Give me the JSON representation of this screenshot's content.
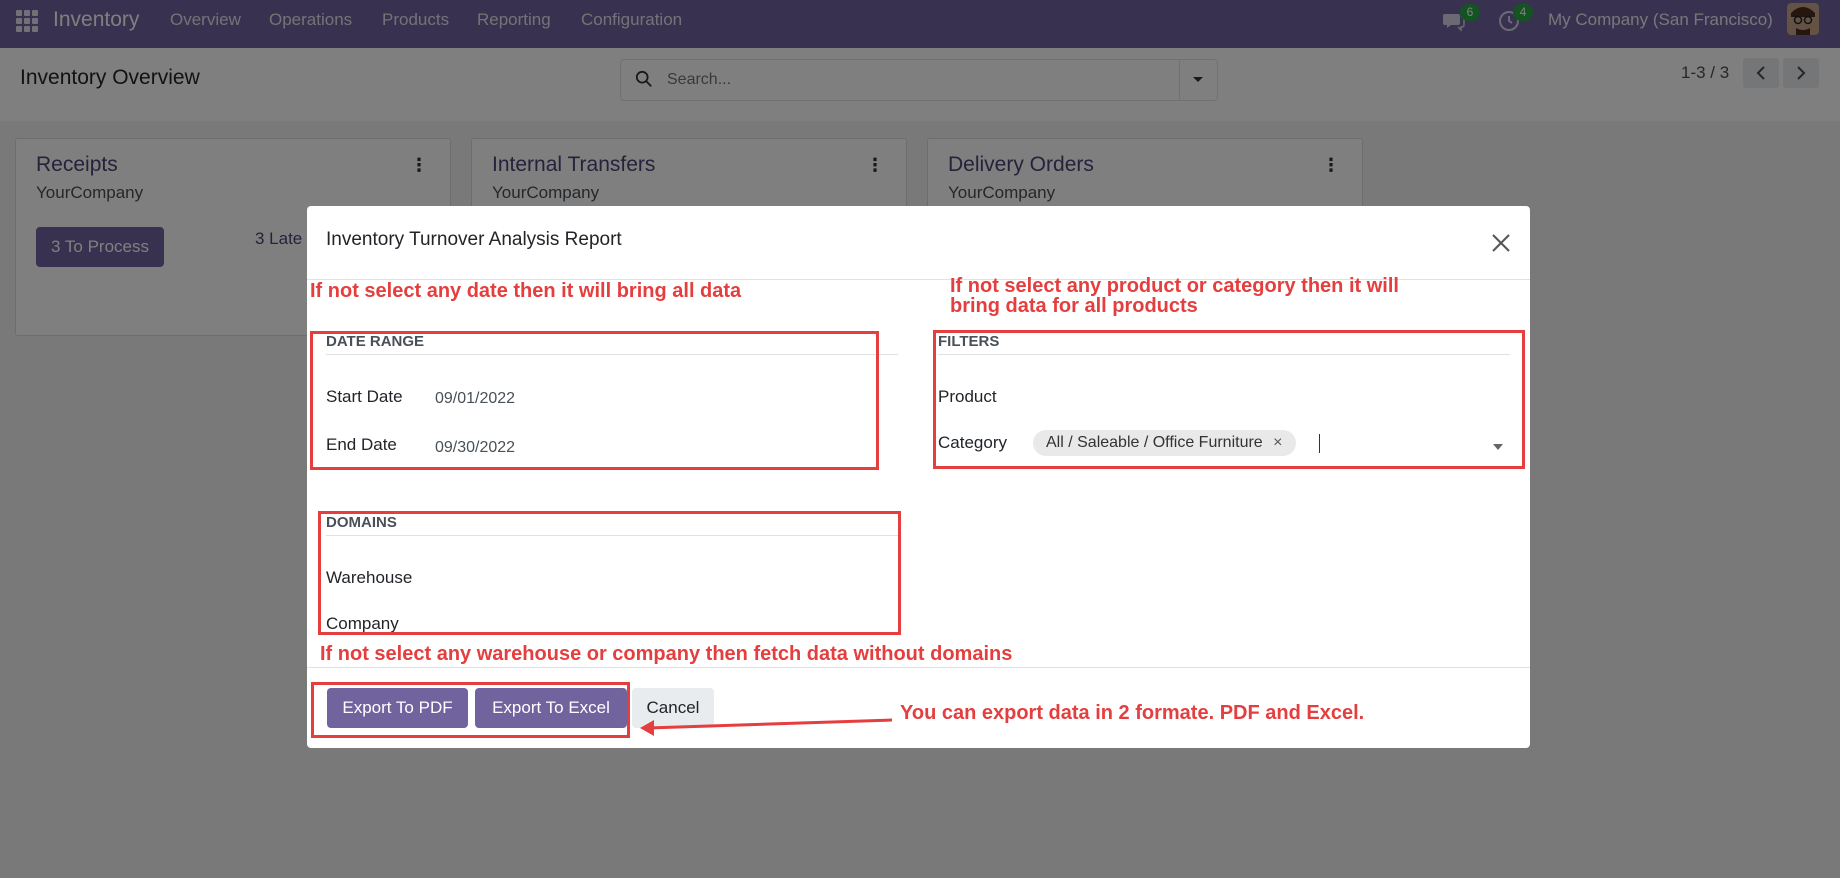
{
  "navbar": {
    "app_name": "Inventory",
    "menu": [
      "Overview",
      "Operations",
      "Products",
      "Reporting",
      "Configuration"
    ],
    "messages_badge": "6",
    "activities_badge": "4",
    "company": "My Company (San Francisco)"
  },
  "control_panel": {
    "title": "Inventory Overview",
    "search_placeholder": "Search...",
    "pager": "1-3 / 3"
  },
  "cards": [
    {
      "title": "Receipts",
      "company": "YourCompany",
      "button": "3 To Process",
      "late": "3 Late"
    },
    {
      "title": "Internal Transfers",
      "company": "YourCompany"
    },
    {
      "title": "Delivery Orders",
      "company": "YourCompany"
    }
  ],
  "modal": {
    "title": "Inventory Turnover Analysis Report",
    "date_range": {
      "heading": "DATE RANGE",
      "start_label": "Start Date",
      "start_value": "09/01/2022",
      "end_label": "End Date",
      "end_value": "09/30/2022"
    },
    "filters": {
      "heading": "FILTERS",
      "product_label": "Product",
      "category_label": "Category",
      "category_tag": "All / Saleable / Office Furniture"
    },
    "domains": {
      "heading": "DOMAINS",
      "warehouse_label": "Warehouse",
      "company_label": "Company"
    },
    "buttons": {
      "pdf": "Export To PDF",
      "excel": "Export To Excel",
      "cancel": "Cancel"
    }
  },
  "annotations": {
    "date_note": "If not select any date then it will bring all data",
    "filter_note_1": "If not select any product or category then it will",
    "filter_note_2": "bring data for all products",
    "domain_note": "If not select any warehouse or company then fetch data without domains",
    "export_note": "You can export data in 2 formate. PDF and Excel."
  },
  "colors": {
    "brand": "#71639e",
    "annotation": "#e53e3e",
    "badge": "#28a745"
  }
}
